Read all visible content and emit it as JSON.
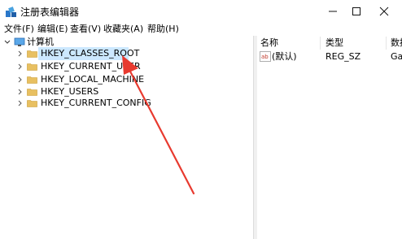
{
  "window": {
    "title": "注册表编辑器",
    "controls": [
      "minimize",
      "maximize",
      "close"
    ]
  },
  "menu": [
    "文件(F)",
    "编辑(E)",
    "查看(V)",
    "收藏夹(A)",
    "帮助(H)"
  ],
  "tree": {
    "root": "计算机",
    "children": [
      {
        "label": "HKEY_CLASSES_ROOT",
        "selected": true
      },
      {
        "label": "HKEY_CURRENT_USER",
        "selected": false
      },
      {
        "label": "HKEY_LOCAL_MACHINE",
        "selected": false
      },
      {
        "label": "HKEY_USERS",
        "selected": false
      },
      {
        "label": "HKEY_CURRENT_CONFIG",
        "selected": false
      }
    ]
  },
  "list": {
    "columns": [
      "名称",
      "类型",
      "数据"
    ],
    "rows": [
      {
        "icon": "ab",
        "name": "(默认)",
        "type": "REG_SZ",
        "data": "Ga"
      }
    ]
  },
  "colors": {
    "selection": "#cce8ff",
    "folder": "#e8c061",
    "arrow": "#e83a2f"
  }
}
